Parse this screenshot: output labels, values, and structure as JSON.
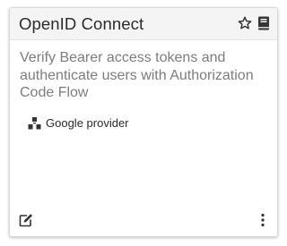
{
  "card": {
    "title": "OpenID Connect",
    "description": "Verify Bearer access tokens and authenticate users with Authorization Code Flow",
    "provider": {
      "label": "Google provider",
      "icon": "cubes-icon"
    },
    "header_icons": [
      "star-outline-icon",
      "book-icon"
    ],
    "footer_icons": [
      "edit-icon",
      "kebab-menu-icon"
    ]
  },
  "colors": {
    "header_background": "#f4f4f4",
    "title_text": "#2b2b2b",
    "description_text": "#7d7d7d",
    "icon": "#333333",
    "border": "#d9d9d9"
  }
}
